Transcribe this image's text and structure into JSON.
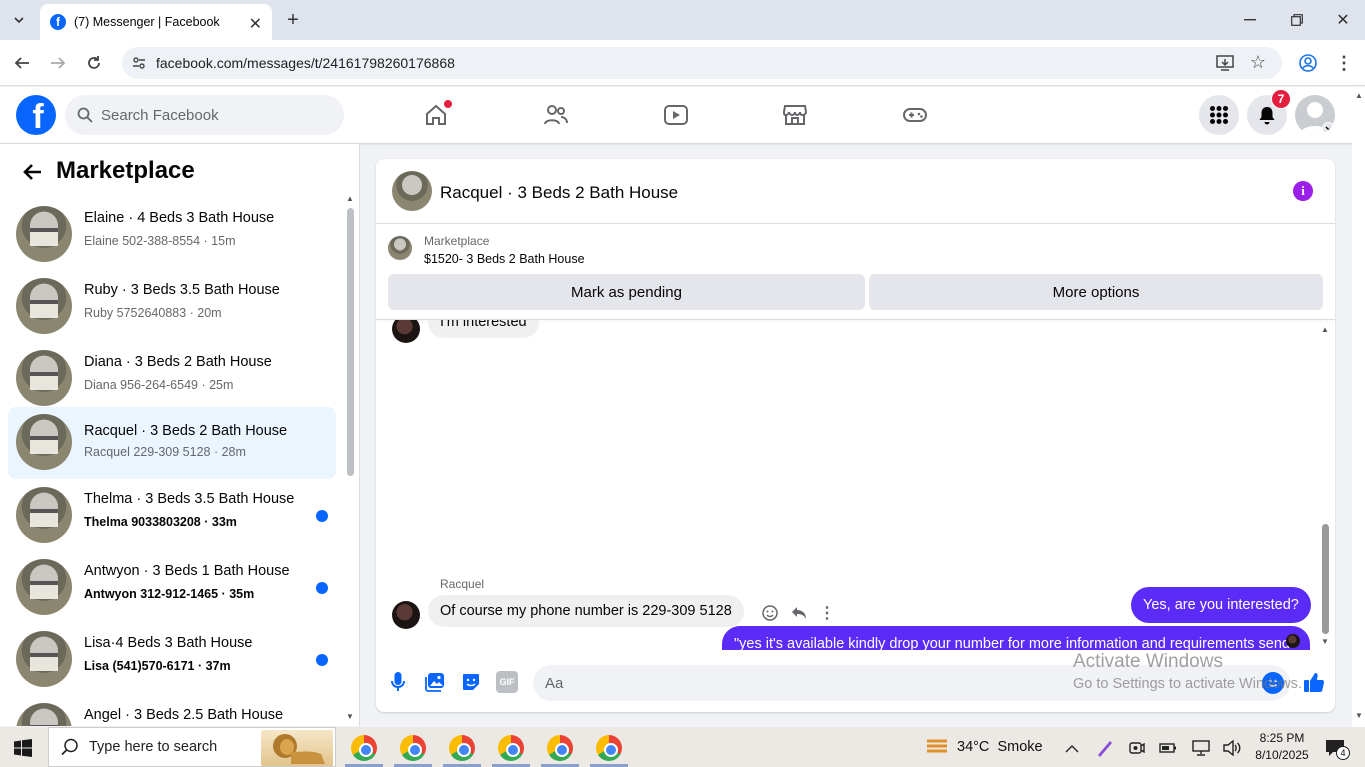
{
  "browser": {
    "tab_title": "(7) Messenger | Facebook",
    "url": "facebook.com/messages/t/24161798260176868"
  },
  "fb": {
    "search_placeholder": "Search Facebook",
    "notification_count": "7",
    "accent_color": "#0866ff"
  },
  "sidebar": {
    "title": "Marketplace",
    "conversations": [
      {
        "title": "Elaine · 4 Beds 3 Bath House",
        "sub": "Elaine 502-388-8554 · 15m",
        "unread": false
      },
      {
        "title": "Ruby · 3 Beds 3.5 Bath House",
        "sub": "Ruby 5752640883 · 20m",
        "unread": false
      },
      {
        "title": "Diana · 3 Beds 2 Bath House",
        "sub": "Diana 956-264-6549 · 25m",
        "unread": false
      },
      {
        "title": "Racquel · 3 Beds 2 Bath House",
        "sub": "Racquel 229-309 5128 · 28m",
        "unread": false
      },
      {
        "title": "Thelma · 3 Beds 3.5 Bath House",
        "sub": "Thelma 9033803208 · 33m",
        "unread": true
      },
      {
        "title": "Antwyon · 3 Beds 1 Bath House",
        "sub": "Antwyon 312-912-1465 · 35m",
        "unread": true
      },
      {
        "title": "Lisa·4 Beds 3 Bath House",
        "sub": "Lisa (541)570-6171 · 37m",
        "unread": true
      },
      {
        "title": "Angel · 3 Beds 2.5 Bath House",
        "sub": "",
        "unread": false
      }
    ]
  },
  "chat": {
    "header_title": "Racquel · 3 Beds 2 Bath House",
    "listing_label": "Marketplace",
    "listing_title": "$1520- 3 Beds 2 Bath House",
    "mark_pending": "Mark as pending",
    "more_options": "More options",
    "messages": {
      "in_partial": "I'm interested",
      "out_1": "Yes, are you interested?",
      "out_2": "\"yes it's available kindly drop your number for more information and requirements send me your number",
      "sender_name": "Racquel",
      "in_last": "Of course my phone number is 229-309 5128"
    },
    "composer_placeholder": "Aa",
    "watermark_title": "Activate Windows",
    "watermark_sub": "Go to Settings to activate Windows."
  },
  "taskbar": {
    "search_placeholder": "Type here to search",
    "weather": "34°C  Smoke",
    "time": "8:25 PM",
    "date": "8/10/2025",
    "notif_count": "4"
  }
}
